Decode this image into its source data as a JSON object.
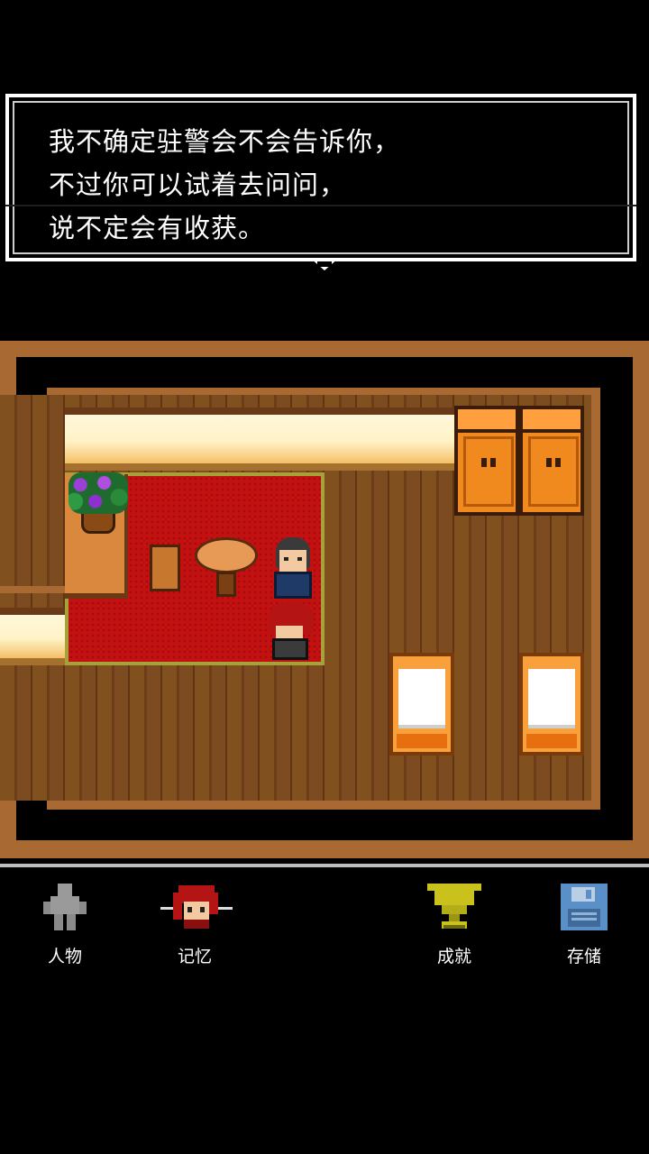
{
  "dialog": {
    "lines": [
      "我不确定驻警会不会告诉你，",
      "不过你可以试着去问问，",
      "说不定会有收获。"
    ]
  },
  "menu": {
    "items": [
      {
        "label": "人物",
        "icon": "person-icon"
      },
      {
        "label": "记忆",
        "icon": "memory-girl-icon"
      },
      {
        "label": "成就",
        "icon": "trophy-icon"
      },
      {
        "label": "存储",
        "icon": "floppy-disk-icon"
      }
    ]
  },
  "colors": {
    "rug": "#c21111",
    "floor": "#7a4a22",
    "wall_frame": "#a86a32",
    "trophy": "#c9c21c",
    "floppy": "#5b8fc7"
  }
}
